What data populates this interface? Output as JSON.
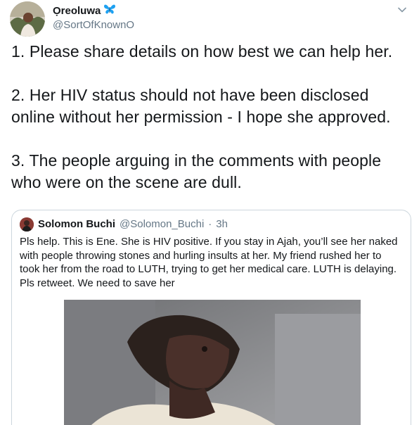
{
  "author": {
    "display_name": "Ọreoluwa",
    "name_emoji": "butterfly-emoji",
    "handle": "@SortOfKnownO"
  },
  "tweet": {
    "paragraphs": [
      "1. Please share details on how best we can help her.",
      "2. Her HIV status should not have been disclosed online without her permission - I hope she approved.",
      "3. The people arguing in the comments with people who were on the scene are dull."
    ]
  },
  "quoted_tweet": {
    "display_name": "Solomon Buchi",
    "handle": "@Solomon_Buchi",
    "separator": "·",
    "time": "3h",
    "text": "Pls help. This is Ene. She is HIV positive. If you stay in Ajah, you’ll see her naked with people throwing stones and hurling insults at her. My friend rushed her to took her from the road to LUTH, trying to get her medical care. LUTH is delaying. Pls retweet. We need to save her"
  },
  "icons": {
    "menu": "chevron-down-icon"
  },
  "colors": {
    "text_primary": "#14171a",
    "text_secondary": "#657786",
    "border": "#ccd6dd",
    "butterfly": "#1da1f2"
  }
}
